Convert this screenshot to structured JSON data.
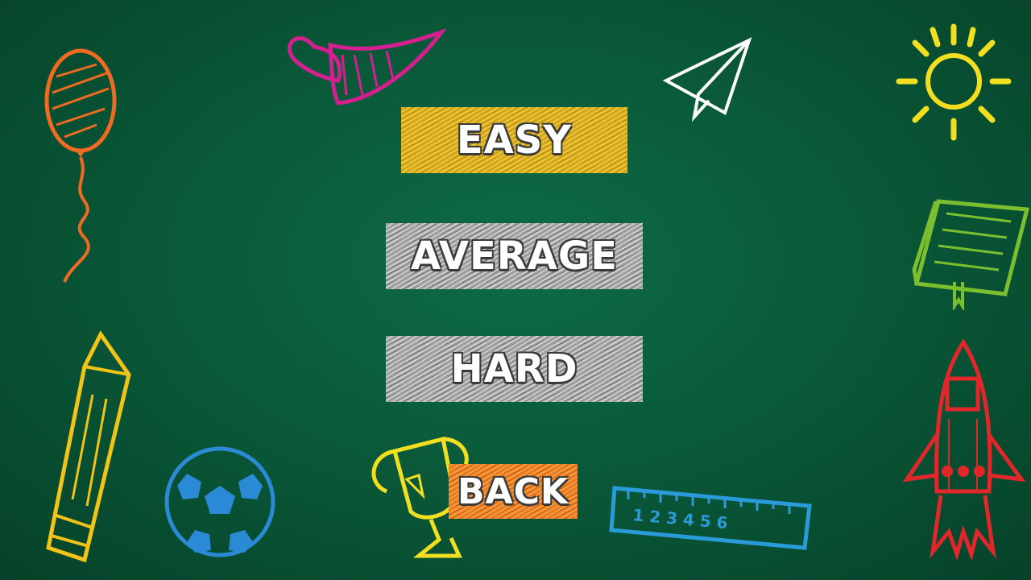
{
  "menu": {
    "easy_label": "EASY",
    "average_label": "AVERAGE",
    "hard_label": "HARD",
    "back_label": "BACK"
  },
  "colors": {
    "board": "#0a5a3a",
    "easy": "#d6a612",
    "average": "#9c9c9c",
    "hard": "#9c9c9c",
    "back": "#ec7a1c"
  },
  "decorations": [
    "balloon-icon",
    "heart-banner-icon",
    "paper-plane-icon",
    "sun-icon",
    "book-icon",
    "pencil-icon",
    "soccer-ball-icon",
    "trophy-icon",
    "ruler-icon",
    "rocket-icon"
  ],
  "ruler_numbers": "1 2 3 4 5 6"
}
